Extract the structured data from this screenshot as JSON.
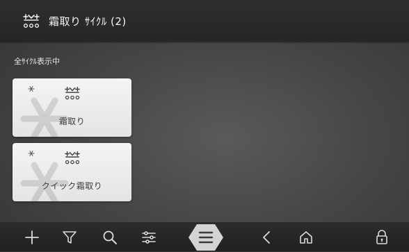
{
  "header": {
    "title": "霜取り ｻｲｸﾙ (2)",
    "icon": "defrost-icon"
  },
  "status_text": "全ｻｲｸﾙ表示中",
  "cards": [
    {
      "label": "霜取り",
      "icon": "defrost-icon"
    },
    {
      "label": "クイック霜取り",
      "icon": "defrost-icon"
    }
  ],
  "navbar": {
    "items": [
      "add-icon",
      "filter-icon",
      "search-icon",
      "sliders-icon",
      "menu-icon",
      "back-icon",
      "home-icon",
      "lock-icon"
    ],
    "menu_accent": "#d3d3d3"
  }
}
